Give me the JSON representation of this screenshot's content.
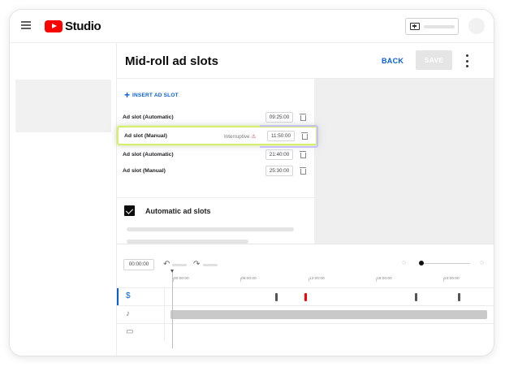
{
  "app": {
    "name": "Studio"
  },
  "page": {
    "title": "Mid-roll ad slots",
    "back_label": "BACK",
    "save_label": "SAVE"
  },
  "panel": {
    "insert_label": "INSERT AD SLOT",
    "slots": [
      {
        "name": "Ad slot (Automatic)",
        "warning": "",
        "time": "09:25:00"
      },
      {
        "name": "Ad slot (Manual)",
        "warning": "Interruptive",
        "time": "11:50:00"
      },
      {
        "name": "Ad slot (Automatic)",
        "warning": "",
        "time": "21:40:00"
      },
      {
        "name": "Ad slot (Manual)",
        "warning": "",
        "time": "25:30:00"
      }
    ],
    "auto_label": "Automatic ad slots",
    "auto_checked": true
  },
  "timeline": {
    "current_time": "00:00:00",
    "ticks": [
      "00:00:00",
      "06:00:00",
      "12:00:00",
      "18:00:00",
      "24:00:00"
    ],
    "tracks": [
      {
        "name": "ads",
        "icon": "$"
      },
      {
        "name": "audio",
        "icon": "♪"
      },
      {
        "name": "video",
        "icon": "▭"
      }
    ],
    "ad_markers": [
      {
        "time": "09:25:00",
        "highlighted": false
      },
      {
        "time": "11:50:00",
        "highlighted": true
      },
      {
        "time": "21:40:00",
        "highlighted": false
      },
      {
        "time": "25:30:00",
        "highlighted": false
      }
    ]
  },
  "colors": {
    "brand_red": "#ff0000",
    "accent_blue": "#065fd4",
    "highlight_green": "#d4f06a",
    "highlight_purple": "#c6c0ff"
  }
}
